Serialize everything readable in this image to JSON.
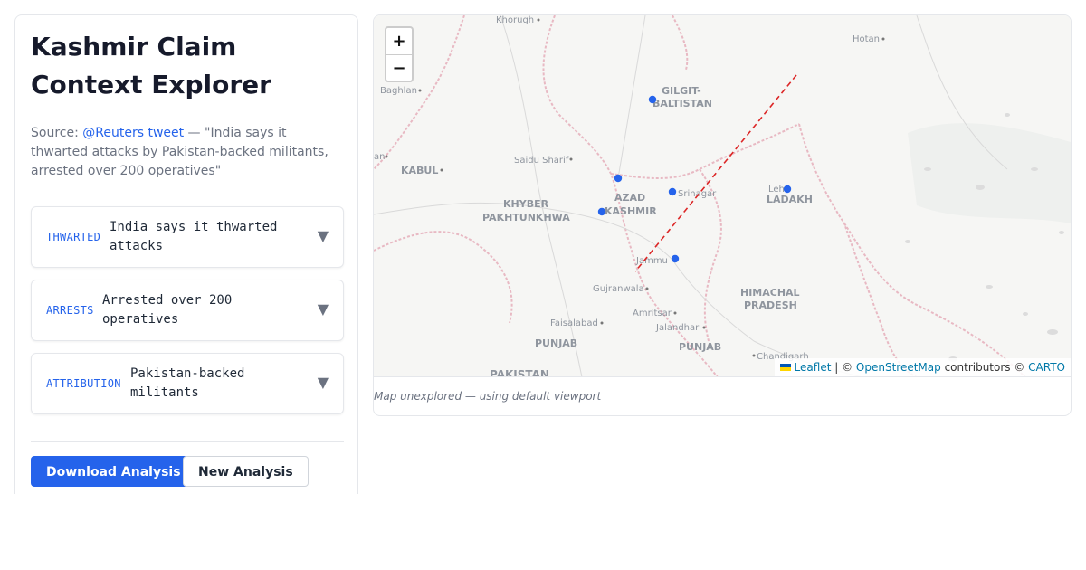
{
  "page": {
    "title": "Kashmir Claim Context Explorer",
    "source_prefix": "Source: ",
    "source_link": "@Reuters tweet",
    "source_quote": " — \"India says it thwarted attacks by Pakistan-backed militants, arrested over 200 operatives\""
  },
  "claims": [
    {
      "tag": "THWARTED",
      "text": "India says it thwarted attacks",
      "chevron": "▼"
    },
    {
      "tag": "ARRESTS",
      "text": "Arrested over 200 operatives",
      "chevron": "▼"
    },
    {
      "tag": "ATTRIBUTION",
      "text": "Pakistan-backed militants",
      "chevron": "▼"
    }
  ],
  "actions": {
    "download_label": "Download Analysis",
    "new_label": "New Analysis"
  },
  "map": {
    "zoom_in": "+",
    "zoom_out": "−",
    "status": "Map unexplored — using default viewport",
    "attribution": {
      "leaflet": "Leaflet",
      "sep": " | © ",
      "osm": "OpenStreetMap",
      "contrib": " contributors © ",
      "carto": "CARTO"
    },
    "labels": {
      "khorugh": "Khorugh",
      "hotan": "Hotan",
      "baghlan": "Baghlan",
      "gilgit1": "GILGIT-",
      "gilgit2": "BALTISTAN",
      "kan": "an",
      "kabul": "KABUL",
      "saidu": "Saidu Sharif",
      "khyber1": "KHYBER",
      "khyber2": "PAKHTUNKHWA",
      "azad1": "AZAD",
      "azad2": "KASHMIR",
      "srinagar": "Srinagar",
      "leh": "Leh",
      "ladakh": "LADAKH",
      "jammu": "Jammu",
      "gujranwala": "Gujranwala",
      "himachal1": "HIMACHAL",
      "himachal2": "PRADESH",
      "amritsar": "Amritsar",
      "faisalabad": "Faisalabad",
      "jalandhar": "Jalandhar",
      "punjab_pk": "PUNJAB",
      "punjab_in": "PUNJAB",
      "chandigarh": "Chandigarh",
      "pakistan": "PAKISTAN"
    },
    "colors": {
      "marker": "#2563eb",
      "loc_line": "#dc2626",
      "border": "#e8b9c3",
      "label": "#9ca3af"
    }
  }
}
